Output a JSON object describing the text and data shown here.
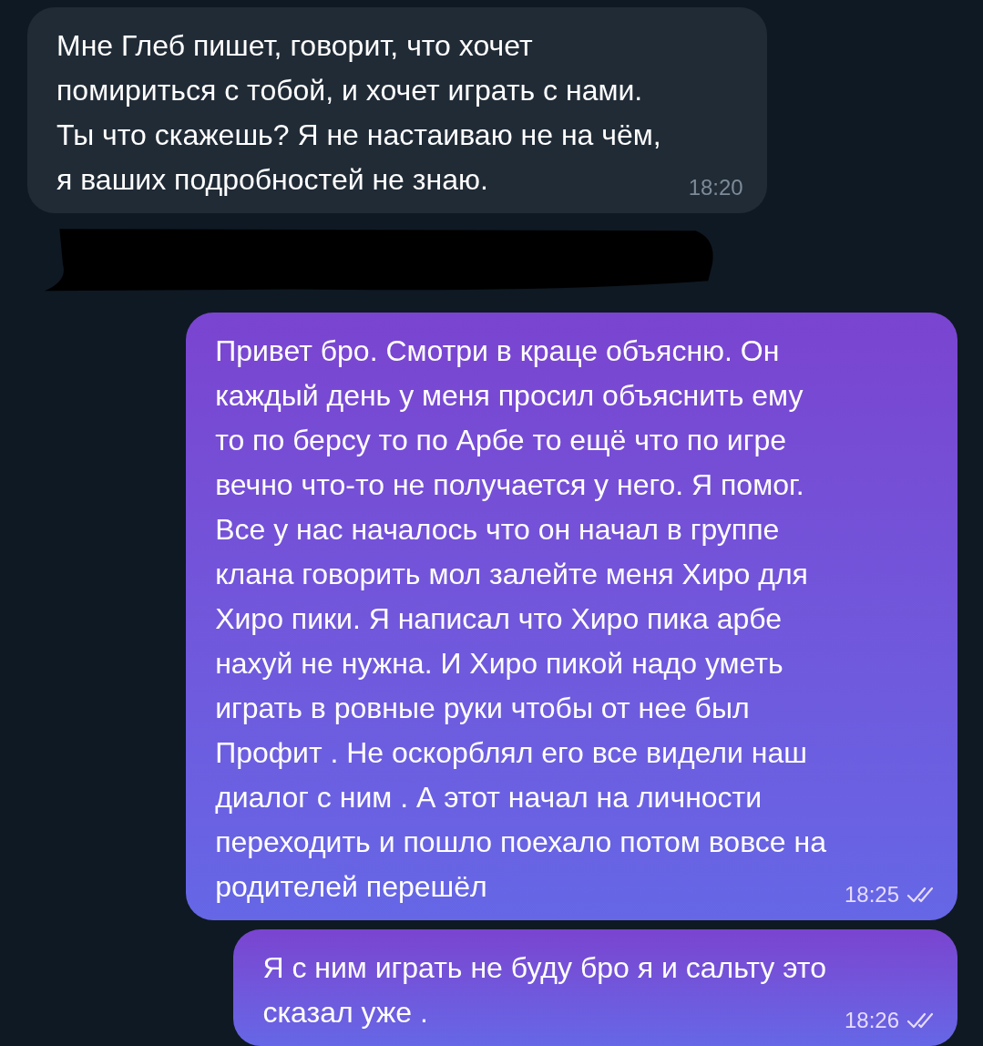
{
  "messages": [
    {
      "kind": "incoming",
      "lines": [
        "Мне Глеб пишет, говорит, что хочет",
        "помириться с тобой, и хочет играть с нами.",
        "Ты что скажешь? Я не настаиваю не на чём,",
        "я ваших подробностей не знаю."
      ],
      "time": "18:20"
    },
    {
      "kind": "redacted"
    },
    {
      "kind": "outgoing",
      "lines": [
        "Привет бро. Смотри в краце объясню. Он",
        "каждый день у меня просил объяснить ему",
        "то по берсу то по Арбе то ещё что по игре",
        "вечно что-то не получается у него. Я помог.",
        "Все у нас началось что он начал в группе",
        "клана говорить мол залейте меня Хиро для",
        "Хиро пики. Я написал что Хиро пика арбе",
        "нахуй не нужна. И Хиро пикой надо уметь",
        "играть в ровные руки чтобы от нее был",
        "Профит . Не оскорблял его все видели наш",
        "диалог с ним . А этот начал на личности",
        "переходить и пошло поехало потом вовсе на",
        "родителей перешёл"
      ],
      "time": "18:25",
      "read": true
    },
    {
      "kind": "outgoing",
      "lines": [
        "Я с ним играть не буду бро я и сальту это",
        "сказал уже ."
      ],
      "time": "18:26",
      "read": true
    }
  ]
}
